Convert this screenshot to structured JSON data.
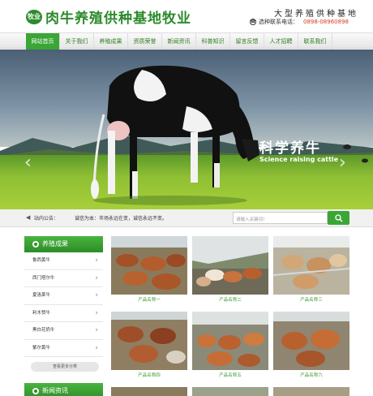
{
  "header": {
    "logo_badge": "牧业",
    "site_title": "肉牛养殖供种基地牧业",
    "slogan": "大型养殖供种基地",
    "phone_label": "选种联系电话：",
    "phone_number": "0898-08960898"
  },
  "nav": {
    "items": [
      "网站首页",
      "关于我们",
      "养殖成果",
      "资质荣誉",
      "新闻资讯",
      "科普知识",
      "留言反馈",
      "人才招聘",
      "联系我们"
    ]
  },
  "banner": {
    "title": "科学养牛",
    "subtitle": "Science raising cattle",
    "prev_arrow": "‹",
    "next_arrow": "›"
  },
  "notice": {
    "label": "站内公告：",
    "text": "诚信为本：市场永远在变，诚信永远不变。"
  },
  "search": {
    "placeholder": "请输入关键词！"
  },
  "sidebar": {
    "title": "养殖成果",
    "items": [
      "鲁西黄牛",
      "西门塔尔牛",
      "夏洛莱牛",
      "利木赞牛",
      "黑白花奶牛",
      "紫尔黄牛"
    ],
    "more": "查看更多分类",
    "title2": "新闻资讯"
  },
  "products": [
    {
      "caption": "产品名称一"
    },
    {
      "caption": "产品名称二"
    },
    {
      "caption": "产品名称三"
    },
    {
      "caption": "产品名称四"
    },
    {
      "caption": "产品名称五"
    },
    {
      "caption": "产品名称六"
    }
  ],
  "colors": {
    "brand_green": "#3aa635",
    "phone_red": "#d93b1b"
  },
  "icons": {
    "notice": "speaker-icon",
    "search": "search-icon",
    "phone": "phone-icon",
    "chevron": "chevron-right-icon"
  }
}
